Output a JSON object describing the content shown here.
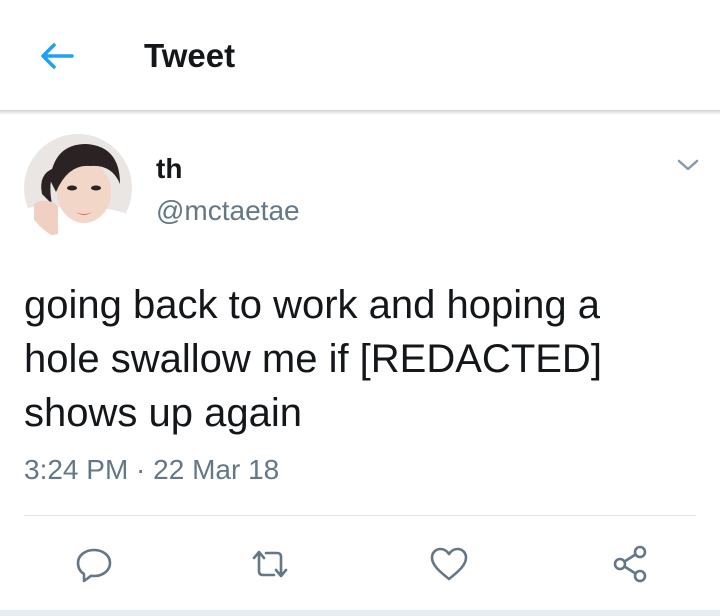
{
  "header": {
    "title": "Tweet",
    "back_icon": "arrow-left-icon",
    "accent_color": "#1da1f2"
  },
  "tweet": {
    "author": {
      "display_name": "th",
      "handle": "@mctaetae"
    },
    "text_lines": [
      "going back to work and hoping a",
      "hole swallow me if [REDACTED]",
      "shows up again"
    ],
    "timestamp": "3:24 PM · 22 Mar 18"
  },
  "actions": [
    {
      "name": "reply",
      "icon": "reply-icon"
    },
    {
      "name": "retweet",
      "icon": "retweet-icon"
    },
    {
      "name": "like",
      "icon": "heart-icon"
    },
    {
      "name": "share",
      "icon": "share-icon"
    }
  ],
  "colors": {
    "text_primary": "#14171a",
    "text_secondary": "#657786",
    "icon_gray": "#657786"
  }
}
